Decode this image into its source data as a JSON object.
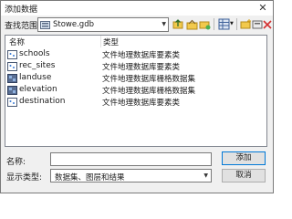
{
  "window": {
    "title": "添加数据",
    "close_glyph": "✕"
  },
  "toolbar": {
    "look_in_label": "查找范围",
    "look_in_value": "Stowe.gdb",
    "buttons": [
      "up-one-level-icon",
      "home-folder-icon",
      "connect-folder-icon",
      "toggle-contents-panel-icon",
      "list-view-icon",
      "new-folder-icon",
      "new-geodatabase-icon",
      "refresh-icon",
      "delete-icon",
      "catalog-icon"
    ]
  },
  "list": {
    "columns": [
      "名称",
      "类型"
    ],
    "rows": [
      {
        "name": "schools",
        "type": "文件地理数据库要素类",
        "icon": "point-feature-class-icon"
      },
      {
        "name": "rec_sites",
        "type": "文件地理数据库要素类",
        "icon": "point-feature-class-icon"
      },
      {
        "name": "landuse",
        "type": "文件地理数据库栅格数据集",
        "icon": "raster-dataset-icon"
      },
      {
        "name": "elevation",
        "type": "文件地理数据库栅格数据集",
        "icon": "raster-dataset-icon"
      },
      {
        "name": "destination",
        "type": "文件地理数据库要素类",
        "icon": "point-feature-class-icon"
      }
    ]
  },
  "name_field": {
    "label": "名称:",
    "value": ""
  },
  "filter": {
    "label": "显示类型:",
    "value": "数据集、图层和结果"
  },
  "buttons": {
    "add": "添加",
    "cancel": "取消"
  }
}
